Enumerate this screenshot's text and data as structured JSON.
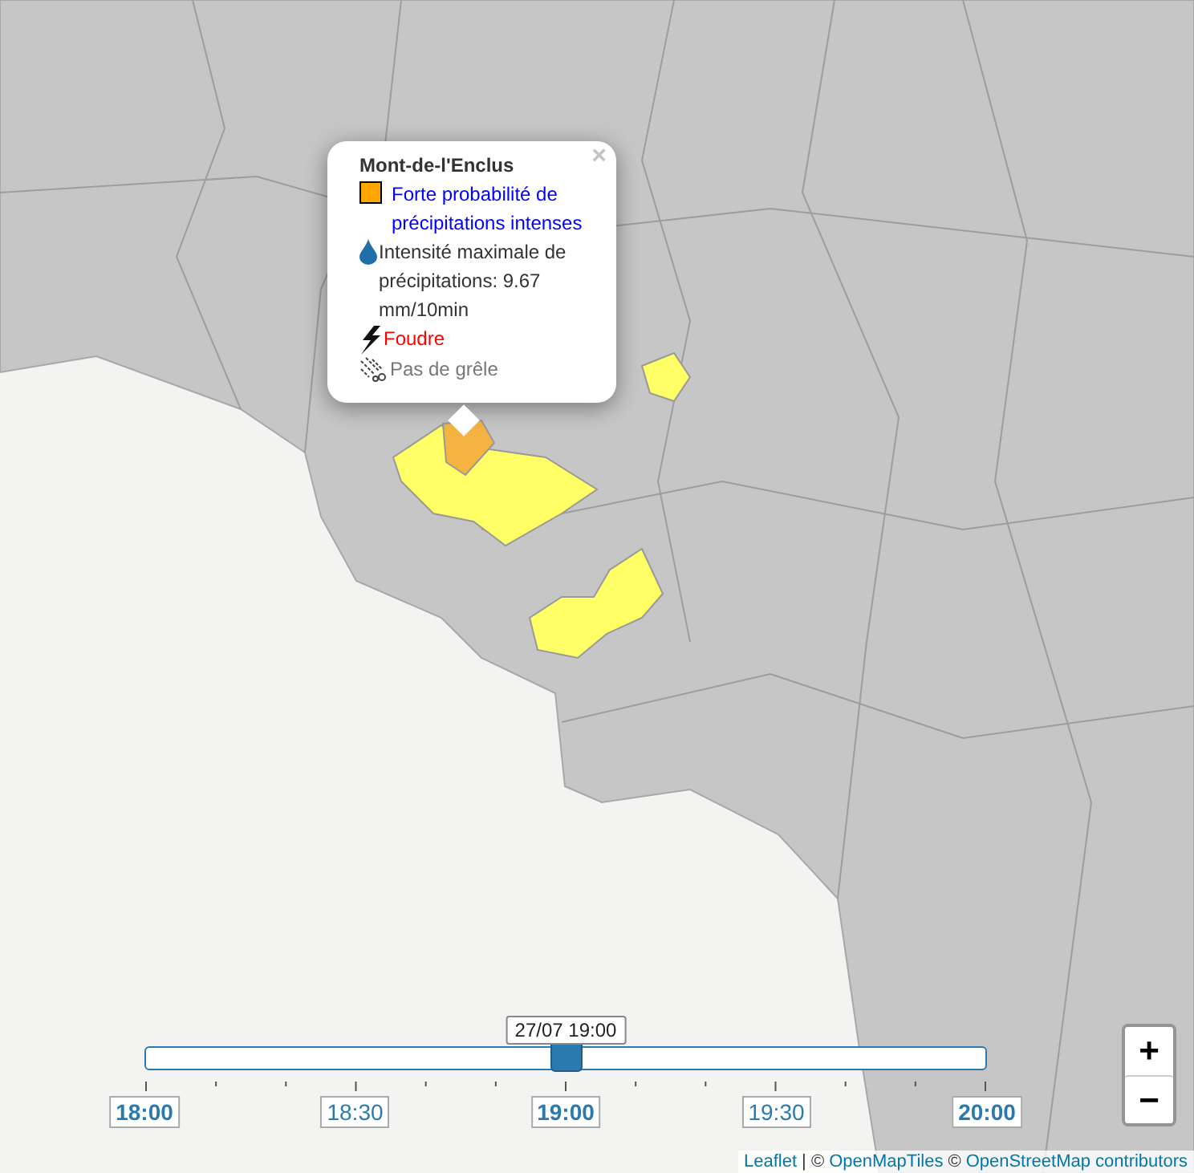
{
  "map": {
    "areas": [
      {
        "color": "#ffff66"
      },
      {
        "color": "#ffff66"
      },
      {
        "color": "#ffff66"
      },
      {
        "color": "#f5b342"
      }
    ]
  },
  "popup": {
    "title": "Mont-de-l'Enclus",
    "close": "×",
    "items": [
      {
        "kind": "risk",
        "color": "#ffa500",
        "text": "Forte probabilité de précipitations intenses"
      },
      {
        "kind": "intensity",
        "text": "Intensité maximale de précipitations: 9.67 mm/10min"
      },
      {
        "kind": "lightning",
        "text": "Foudre"
      },
      {
        "kind": "hail",
        "text": "Pas de grêle"
      }
    ]
  },
  "slider": {
    "tooltip": "27/07 19:00",
    "level": 0.5,
    "labels": [
      {
        "text": "18:00",
        "kind": "major"
      },
      {
        "text": "18:30",
        "kind": "minor"
      },
      {
        "text": "19:00",
        "kind": "major"
      },
      {
        "text": "19:30",
        "kind": "minor"
      },
      {
        "text": "20:00",
        "kind": "major"
      }
    ]
  },
  "zoom": {
    "in": "+",
    "out": "−"
  },
  "attribution": [
    {
      "kind": "link",
      "text": "Leaflet"
    },
    {
      "kind": "text",
      "text": "| ©"
    },
    {
      "kind": "link",
      "text": "OpenMapTiles"
    },
    {
      "kind": "text",
      "text": "©"
    },
    {
      "kind": "link",
      "text": "OpenStreetMap contributors"
    }
  ]
}
